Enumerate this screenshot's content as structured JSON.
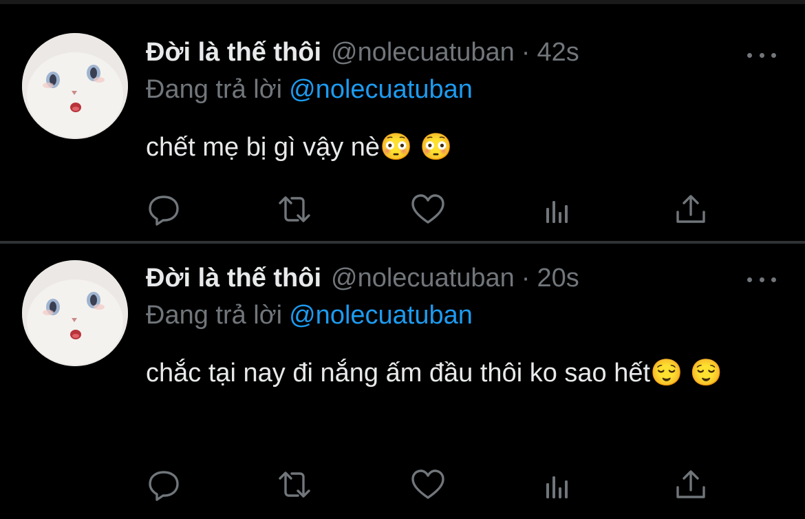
{
  "colors": {
    "background": "#000000",
    "primary_text": "#e7e9ea",
    "secondary_text": "#71767b",
    "accent": "#1d9bf0",
    "divider": "#2f3336"
  },
  "tweets": [
    {
      "display_name": "Đời là thế thôi",
      "handle": "@nolecuatuban",
      "separator": "·",
      "time": "42s",
      "reply_prefix": "Đang trả lời",
      "reply_to": "@nolecuatuban",
      "text": "chết mẹ bị gì vậy nè😳 😳",
      "avatar_icon": "white-kitten-avatar",
      "actions": [
        "reply-icon",
        "retweet-icon",
        "like-icon",
        "analytics-icon",
        "share-icon"
      ]
    },
    {
      "display_name": "Đời là thế thôi",
      "handle": "@nolecuatuban",
      "separator": "·",
      "time": "20s",
      "reply_prefix": "Đang trả lời",
      "reply_to": "@nolecuatuban",
      "text": "chắc tại nay đi nắng ấm đầu thôi ko sao hết😌 😌",
      "avatar_icon": "white-kitten-avatar",
      "actions": [
        "reply-icon",
        "retweet-icon",
        "like-icon",
        "analytics-icon",
        "share-icon"
      ]
    }
  ]
}
